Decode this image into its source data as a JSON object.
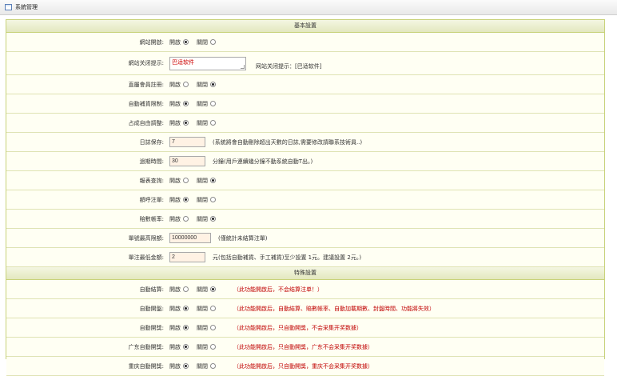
{
  "window": {
    "title": "系統管理"
  },
  "sections": {
    "basic": "基本設置",
    "special": "特殊設置"
  },
  "options": {
    "on": "開啟",
    "off": "關閉"
  },
  "basic_rows": [
    {
      "label": "網站開啟:",
      "selected": "on"
    },
    {
      "label": "網站关闭提示:",
      "textarea_value": "巴适软件",
      "current_hint": "网站关闭提示：[巴适软件]"
    },
    {
      "label": "直屬會員註冊:",
      "selected": "off"
    },
    {
      "label": "自動補貨限制:",
      "selected": "on"
    },
    {
      "label": "占成自由調整:",
      "selected": "on"
    },
    {
      "label": "日誌保存:",
      "input_value": "7",
      "hint": "(系統將會自動刪除超出天數的日誌,需要修改請聯系技術員..)"
    },
    {
      "label": "過期時間:",
      "input_value": "30",
      "hint": "分鐘(用戶連續幾分鐘不動系統自動T出。)"
    },
    {
      "label": "報表查詢:",
      "selected": "off"
    },
    {
      "label": "額呼注單:",
      "selected": "on"
    },
    {
      "label": "賠數帳率:",
      "selected": "off"
    },
    {
      "label": "單號最高限額:",
      "input_value": "10000000",
      "hint": "(僅統計未結算注單)"
    },
    {
      "label": "單注最低金額:",
      "input_value": "2",
      "hint": "元(包括自動補貨、手工補貨)至少設置 1元。建議設置 2元。)"
    }
  ],
  "special_rows": [
    {
      "label": "自動結算:",
      "selected": "off",
      "note": "（此功能開啟后，不会结算注单！）"
    },
    {
      "label": "自動開盤:",
      "selected": "on",
      "note": "（此功能開啟后，自動結算、賠數帳率、自動加載期數、封盤時間、功能將失效）"
    },
    {
      "label": "自動開獎:",
      "selected": "on",
      "note": "（此功能開啟后，只自動開獎，不会采集开奖数據）"
    },
    {
      "label": "广东自動開獎:",
      "selected": "on",
      "note": "（此功能開啟后，只自動開獎，广东不会采集开奖数據）"
    },
    {
      "label": "重庆自動開獎:",
      "selected": "on",
      "note": "（此功能開啟后，只自動開獎，重庆不会采集开奖数據）"
    }
  ]
}
